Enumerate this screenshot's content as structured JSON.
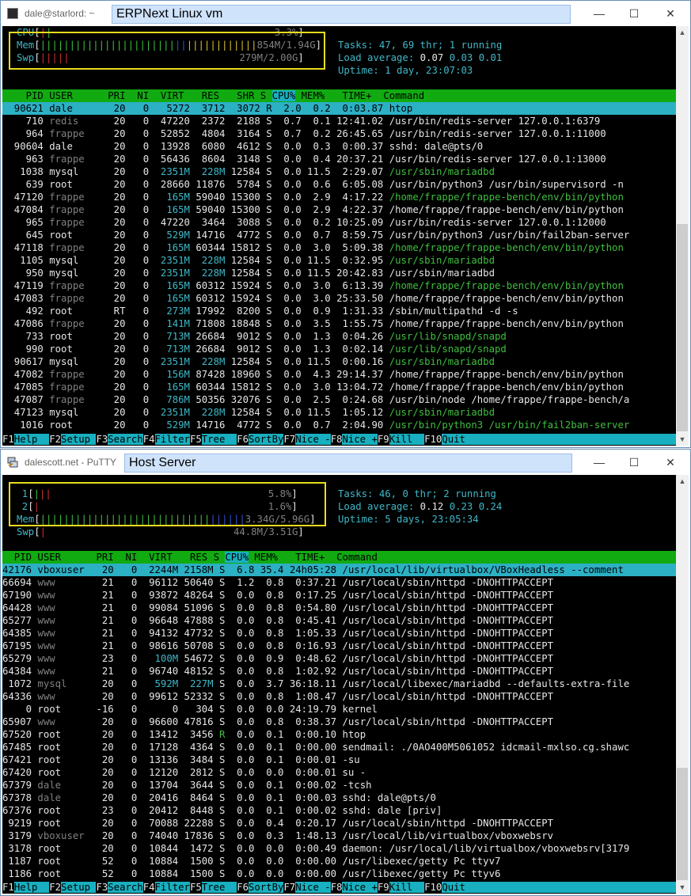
{
  "win1": {
    "app_title": "dale@starlord: ~",
    "label": "ERPNext Linux vm",
    "meters": {
      "cpu_label": "CPU",
      "cpu_value": "3.3%",
      "mem_label": "Mem",
      "mem_value": "854M/1.94G",
      "swp_label": "Swp",
      "swp_value": "279M/2.00G"
    },
    "summary": {
      "tasks_label": "Tasks:",
      "tasks_value": "47,",
      "thr_value": "69",
      "thr_label": "thr;",
      "running_value": "1",
      "running_label": "running",
      "load_label": "Load average:",
      "load1": "0.07",
      "load5": "0.03",
      "load15": "0.01",
      "uptime_label": "Uptime:",
      "uptime_value": "1 day, 23:07:03"
    },
    "header": "    PID USER      PRI  NI  VIRT   RES   SHR S CPU% MEM%   TIME+  Command",
    "rows": [
      {
        "pid": "90621",
        "user": "dale",
        "pri": "20",
        "ni": "0",
        "virt": "5272",
        "res": "3712",
        "shr": "3072",
        "s": "R",
        "cpu": "2.0",
        "mem": "0.2",
        "time": "0:03.87",
        "cmd": "htop",
        "sel": true
      },
      {
        "pid": "710",
        "user": "redis",
        "pri": "20",
        "ni": "0",
        "virt": "47220",
        "res": "2372",
        "shr": "2188",
        "s": "S",
        "cpu": "0.7",
        "mem": "0.1",
        "time": "12:41.02",
        "cmd": "/usr/bin/redis-server 127.0.0.1:6379"
      },
      {
        "pid": "964",
        "user": "frappe",
        "pri": "20",
        "ni": "0",
        "virt": "52852",
        "res": "4804",
        "shr": "3164",
        "s": "S",
        "cpu": "0.7",
        "mem": "0.2",
        "time": "26:45.65",
        "cmd": "/usr/bin/redis-server 127.0.0.1:11000"
      },
      {
        "pid": "90604",
        "user": "dale",
        "pri": "20",
        "ni": "0",
        "virt": "13928",
        "res": "6080",
        "shr": "4612",
        "s": "S",
        "cpu": "0.0",
        "mem": "0.3",
        "time": "0:00.37",
        "cmd": "sshd: dale@pts/0"
      },
      {
        "pid": "963",
        "user": "frappe",
        "pri": "20",
        "ni": "0",
        "virt": "56436",
        "res": "8604",
        "shr": "3148",
        "s": "S",
        "cpu": "0.0",
        "mem": "0.4",
        "time": "20:37.21",
        "cmd": "/usr/bin/redis-server 127.0.0.1:13000"
      },
      {
        "pid": "1038",
        "user": "mysql",
        "pri": "20",
        "ni": "0",
        "virt": "2351M",
        "res": "228M",
        "shr": "12584",
        "s": "S",
        "cpu": "0.0",
        "mem": "11.5",
        "time": "2:29.07",
        "cmd": "/usr/sbin/mariadbd",
        "green": true
      },
      {
        "pid": "639",
        "user": "root",
        "pri": "20",
        "ni": "0",
        "virt": "28660",
        "res": "11876",
        "shr": "5784",
        "s": "S",
        "cpu": "0.0",
        "mem": "0.6",
        "time": "6:05.08",
        "cmd": "/usr/bin/python3 /usr/bin/supervisord -n"
      },
      {
        "pid": "47120",
        "user": "frappe",
        "pri": "20",
        "ni": "0",
        "virt": "165M",
        "res": "59040",
        "shr": "15300",
        "s": "S",
        "cpu": "0.0",
        "mem": "2.9",
        "time": "4:17.22",
        "cmd": "/home/frappe/frappe-bench/env/bin/python",
        "green": true
      },
      {
        "pid": "47084",
        "user": "frappe",
        "pri": "20",
        "ni": "0",
        "virt": "165M",
        "res": "59040",
        "shr": "15300",
        "s": "S",
        "cpu": "0.0",
        "mem": "2.9",
        "time": "4:22.37",
        "cmd": "/home/frappe/frappe-bench/env/bin/python"
      },
      {
        "pid": "965",
        "user": "frappe",
        "pri": "20",
        "ni": "0",
        "virt": "47220",
        "res": "3464",
        "shr": "3088",
        "s": "S",
        "cpu": "0.0",
        "mem": "0.2",
        "time": "10:25.09",
        "cmd": "/usr/bin/redis-server 127.0.0.1:12000"
      },
      {
        "pid": "645",
        "user": "root",
        "pri": "20",
        "ni": "0",
        "virt": "529M",
        "res": "14716",
        "shr": "4772",
        "s": "S",
        "cpu": "0.0",
        "mem": "0.7",
        "time": "8:59.75",
        "cmd": "/usr/bin/python3 /usr/bin/fail2ban-server"
      },
      {
        "pid": "47118",
        "user": "frappe",
        "pri": "20",
        "ni": "0",
        "virt": "165M",
        "res": "60344",
        "shr": "15812",
        "s": "S",
        "cpu": "0.0",
        "mem": "3.0",
        "time": "5:09.38",
        "cmd": "/home/frappe/frappe-bench/env/bin/python",
        "green": true
      },
      {
        "pid": "1105",
        "user": "mysql",
        "pri": "20",
        "ni": "0",
        "virt": "2351M",
        "res": "228M",
        "shr": "12584",
        "s": "S",
        "cpu": "0.0",
        "mem": "11.5",
        "time": "0:32.95",
        "cmd": "/usr/sbin/mariadbd",
        "green": true
      },
      {
        "pid": "950",
        "user": "mysql",
        "pri": "20",
        "ni": "0",
        "virt": "2351M",
        "res": "228M",
        "shr": "12584",
        "s": "S",
        "cpu": "0.0",
        "mem": "11.5",
        "time": "20:42.83",
        "cmd": "/usr/sbin/mariadbd"
      },
      {
        "pid": "47119",
        "user": "frappe",
        "pri": "20",
        "ni": "0",
        "virt": "165M",
        "res": "60312",
        "shr": "15924",
        "s": "S",
        "cpu": "0.0",
        "mem": "3.0",
        "time": "6:13.39",
        "cmd": "/home/frappe/frappe-bench/env/bin/python",
        "green": true
      },
      {
        "pid": "47083",
        "user": "frappe",
        "pri": "20",
        "ni": "0",
        "virt": "165M",
        "res": "60312",
        "shr": "15924",
        "s": "S",
        "cpu": "0.0",
        "mem": "3.0",
        "time": "25:33.50",
        "cmd": "/home/frappe/frappe-bench/env/bin/python"
      },
      {
        "pid": "492",
        "user": "root",
        "pri": "RT",
        "ni": "0",
        "virt": "273M",
        "res": "17992",
        "shr": "8200",
        "s": "S",
        "cpu": "0.0",
        "mem": "0.9",
        "time": "1:31.33",
        "cmd": "/sbin/multipathd -d -s"
      },
      {
        "pid": "47086",
        "user": "frappe",
        "pri": "20",
        "ni": "0",
        "virt": "141M",
        "res": "71808",
        "shr": "18848",
        "s": "S",
        "cpu": "0.0",
        "mem": "3.5",
        "time": "1:55.75",
        "cmd": "/home/frappe/frappe-bench/env/bin/python"
      },
      {
        "pid": "733",
        "user": "root",
        "pri": "20",
        "ni": "0",
        "virt": "713M",
        "res": "26684",
        "shr": "9012",
        "s": "S",
        "cpu": "0.0",
        "mem": "1.3",
        "time": "0:04.26",
        "cmd": "/usr/lib/snapd/snapd",
        "green": true
      },
      {
        "pid": "990",
        "user": "root",
        "pri": "20",
        "ni": "0",
        "virt": "713M",
        "res": "26684",
        "shr": "9012",
        "s": "S",
        "cpu": "0.0",
        "mem": "1.3",
        "time": "0:02.14",
        "cmd": "/usr/lib/snapd/snapd",
        "green": true
      },
      {
        "pid": "90617",
        "user": "mysql",
        "pri": "20",
        "ni": "0",
        "virt": "2351M",
        "res": "228M",
        "shr": "12584",
        "s": "S",
        "cpu": "0.0",
        "mem": "11.5",
        "time": "0:00.16",
        "cmd": "/usr/sbin/mariadbd",
        "green": true
      },
      {
        "pid": "47082",
        "user": "frappe",
        "pri": "20",
        "ni": "0",
        "virt": "156M",
        "res": "87428",
        "shr": "18960",
        "s": "S",
        "cpu": "0.0",
        "mem": "4.3",
        "time": "29:14.37",
        "cmd": "/home/frappe/frappe-bench/env/bin/python"
      },
      {
        "pid": "47085",
        "user": "frappe",
        "pri": "20",
        "ni": "0",
        "virt": "165M",
        "res": "60344",
        "shr": "15812",
        "s": "S",
        "cpu": "0.0",
        "mem": "3.0",
        "time": "13:04.72",
        "cmd": "/home/frappe/frappe-bench/env/bin/python"
      },
      {
        "pid": "47087",
        "user": "frappe",
        "pri": "20",
        "ni": "0",
        "virt": "786M",
        "res": "50356",
        "shr": "32076",
        "s": "S",
        "cpu": "0.0",
        "mem": "2.5",
        "time": "0:24.68",
        "cmd": "/usr/bin/node /home/frappe/frappe-bench/a"
      },
      {
        "pid": "47123",
        "user": "mysql",
        "pri": "20",
        "ni": "0",
        "virt": "2351M",
        "res": "228M",
        "shr": "12584",
        "s": "S",
        "cpu": "0.0",
        "mem": "11.5",
        "time": "1:05.12",
        "cmd": "/usr/sbin/mariadbd",
        "green": true
      },
      {
        "pid": "1016",
        "user": "root",
        "pri": "20",
        "ni": "0",
        "virt": "529M",
        "res": "14716",
        "shr": "4772",
        "s": "S",
        "cpu": "0.0",
        "mem": "0.7",
        "time": "2:04.90",
        "cmd": "/usr/bin/python3 /usr/bin/fail2ban-server",
        "green": true
      }
    ]
  },
  "win2": {
    "app_title": "dalescott.net - PuTTY",
    "label": "Host Server",
    "meters": {
      "cpu1_label": "1",
      "cpu1_value": "5.8%",
      "cpu2_label": "2",
      "cpu2_value": "1.6%",
      "mem_label": "Mem",
      "mem_value": "3.34G/5.96G",
      "swp_label": "Swp",
      "swp_value": "44.8M/3.51G"
    },
    "summary": {
      "tasks_label": "Tasks:",
      "tasks_value": "46,",
      "thr_value": "0",
      "thr_label": "thr;",
      "running_value": "2",
      "running_label": "running",
      "load_label": "Load average:",
      "load1": "0.12",
      "load5": "0.23",
      "load15": "0.24",
      "uptime_label": "Uptime:",
      "uptime_value": "5 days, 23:05:34"
    },
    "header": "  PID USER      PRI  NI  VIRT   RES S CPU% MEM%   TIME+  Command",
    "rows": [
      {
        "pid": "42176",
        "user": "vboxuser",
        "pri": "20",
        "ni": "0",
        "virt": "2244M",
        "res": "2158M",
        "s": "S",
        "cpu": "6.8",
        "mem": "35.4",
        "time": "24h05:28",
        "cmd": "/usr/local/lib/virtualbox/VBoxHeadless --comment",
        "sel": true
      },
      {
        "pid": "66694",
        "user": "www",
        "pri": "21",
        "ni": "0",
        "virt": "96112",
        "res": "50640",
        "s": "S",
        "cpu": "1.2",
        "mem": "0.8",
        "time": "0:37.21",
        "cmd": "/usr/local/sbin/httpd -DNOHTTPACCEPT"
      },
      {
        "pid": "67190",
        "user": "www",
        "pri": "21",
        "ni": "0",
        "virt": "93872",
        "res": "48264",
        "s": "S",
        "cpu": "0.0",
        "mem": "0.8",
        "time": "0:17.25",
        "cmd": "/usr/local/sbin/httpd -DNOHTTPACCEPT"
      },
      {
        "pid": "64428",
        "user": "www",
        "pri": "21",
        "ni": "0",
        "virt": "99084",
        "res": "51096",
        "s": "S",
        "cpu": "0.0",
        "mem": "0.8",
        "time": "0:54.80",
        "cmd": "/usr/local/sbin/httpd -DNOHTTPACCEPT"
      },
      {
        "pid": "65277",
        "user": "www",
        "pri": "21",
        "ni": "0",
        "virt": "96648",
        "res": "47888",
        "s": "S",
        "cpu": "0.0",
        "mem": "0.8",
        "time": "0:45.41",
        "cmd": "/usr/local/sbin/httpd -DNOHTTPACCEPT"
      },
      {
        "pid": "64385",
        "user": "www",
        "pri": "21",
        "ni": "0",
        "virt": "94132",
        "res": "47732",
        "s": "S",
        "cpu": "0.0",
        "mem": "0.8",
        "time": "1:05.33",
        "cmd": "/usr/local/sbin/httpd -DNOHTTPACCEPT"
      },
      {
        "pid": "67195",
        "user": "www",
        "pri": "21",
        "ni": "0",
        "virt": "98616",
        "res": "50708",
        "s": "S",
        "cpu": "0.0",
        "mem": "0.8",
        "time": "0:16.93",
        "cmd": "/usr/local/sbin/httpd -DNOHTTPACCEPT"
      },
      {
        "pid": "65279",
        "user": "www",
        "pri": "23",
        "ni": "0",
        "virt": "100M",
        "res": "54672",
        "s": "S",
        "cpu": "0.0",
        "mem": "0.9",
        "time": "0:48.62",
        "cmd": "/usr/local/sbin/httpd -DNOHTTPACCEPT"
      },
      {
        "pid": "64384",
        "user": "www",
        "pri": "21",
        "ni": "0",
        "virt": "96740",
        "res": "48152",
        "s": "S",
        "cpu": "0.0",
        "mem": "0.8",
        "time": "1:02.92",
        "cmd": "/usr/local/sbin/httpd -DNOHTTPACCEPT"
      },
      {
        "pid": "1072",
        "user": "mysql",
        "pri": "20",
        "ni": "0",
        "virt": "592M",
        "res": "227M",
        "s": "S",
        "cpu": "0.0",
        "mem": "3.7",
        "time": "36:18.11",
        "cmd": "/usr/local/libexec/mariadbd --defaults-extra-file"
      },
      {
        "pid": "64336",
        "user": "www",
        "pri": "20",
        "ni": "0",
        "virt": "99612",
        "res": "52332",
        "s": "S",
        "cpu": "0.0",
        "mem": "0.8",
        "time": "1:08.47",
        "cmd": "/usr/local/sbin/httpd -DNOHTTPACCEPT"
      },
      {
        "pid": "0",
        "user": "root",
        "pri": "-16",
        "ni": "0",
        "virt": "0",
        "res": "304",
        "s": "S",
        "cpu": "0.0",
        "mem": "0.0",
        "time": "24:19.79",
        "cmd": "kernel"
      },
      {
        "pid": "65907",
        "user": "www",
        "pri": "20",
        "ni": "0",
        "virt": "96600",
        "res": "47816",
        "s": "S",
        "cpu": "0.0",
        "mem": "0.8",
        "time": "0:38.37",
        "cmd": "/usr/local/sbin/httpd -DNOHTTPACCEPT"
      },
      {
        "pid": "67520",
        "user": "root",
        "pri": "20",
        "ni": "0",
        "virt": "13412",
        "res": "3456",
        "s": "R",
        "cpu": "0.0",
        "mem": "0.1",
        "time": "0:00.10",
        "cmd": "htop"
      },
      {
        "pid": "67485",
        "user": "root",
        "pri": "20",
        "ni": "0",
        "virt": "17128",
        "res": "4364",
        "s": "S",
        "cpu": "0.0",
        "mem": "0.1",
        "time": "0:00.00",
        "cmd": "sendmail: ./0AO400M5061052 idcmail-mxlso.cg.shawc"
      },
      {
        "pid": "67421",
        "user": "root",
        "pri": "20",
        "ni": "0",
        "virt": "13136",
        "res": "3484",
        "s": "S",
        "cpu": "0.0",
        "mem": "0.1",
        "time": "0:00.01",
        "cmd": "-su"
      },
      {
        "pid": "67420",
        "user": "root",
        "pri": "20",
        "ni": "0",
        "virt": "12120",
        "res": "2812",
        "s": "S",
        "cpu": "0.0",
        "mem": "0.0",
        "time": "0:00.01",
        "cmd": "su -"
      },
      {
        "pid": "67379",
        "user": "dale",
        "pri": "20",
        "ni": "0",
        "virt": "13704",
        "res": "3644",
        "s": "S",
        "cpu": "0.0",
        "mem": "0.1",
        "time": "0:00.02",
        "cmd": "-tcsh"
      },
      {
        "pid": "67378",
        "user": "dale",
        "pri": "20",
        "ni": "0",
        "virt": "20416",
        "res": "8464",
        "s": "S",
        "cpu": "0.0",
        "mem": "0.1",
        "time": "0:00.03",
        "cmd": "sshd: dale@pts/0"
      },
      {
        "pid": "67376",
        "user": "root",
        "pri": "23",
        "ni": "0",
        "virt": "20412",
        "res": "8448",
        "s": "S",
        "cpu": "0.0",
        "mem": "0.1",
        "time": "0:00.02",
        "cmd": "sshd: dale [priv]"
      },
      {
        "pid": "9219",
        "user": "root",
        "pri": "20",
        "ni": "0",
        "virt": "70088",
        "res": "22288",
        "s": "S",
        "cpu": "0.0",
        "mem": "0.4",
        "time": "0:20.17",
        "cmd": "/usr/local/sbin/httpd -DNOHTTPACCEPT"
      },
      {
        "pid": "3179",
        "user": "vboxuser",
        "pri": "20",
        "ni": "0",
        "virt": "74040",
        "res": "17836",
        "s": "S",
        "cpu": "0.0",
        "mem": "0.3",
        "time": "1:48.13",
        "cmd": "/usr/local/lib/virtualbox/vboxwebsrv"
      },
      {
        "pid": "3178",
        "user": "root",
        "pri": "20",
        "ni": "0",
        "virt": "10844",
        "res": "1472",
        "s": "S",
        "cpu": "0.0",
        "mem": "0.0",
        "time": "0:00.49",
        "cmd": "daemon: /usr/local/lib/virtualbox/vboxwebsrv[3179"
      },
      {
        "pid": "1187",
        "user": "root",
        "pri": "52",
        "ni": "0",
        "virt": "10884",
        "res": "1500",
        "s": "S",
        "cpu": "0.0",
        "mem": "0.0",
        "time": "0:00.00",
        "cmd": "/usr/libexec/getty Pc ttyv7"
      },
      {
        "pid": "1186",
        "user": "root",
        "pri": "52",
        "ni": "0",
        "virt": "10884",
        "res": "1500",
        "s": "S",
        "cpu": "0.0",
        "mem": "0.0",
        "time": "0:00.00",
        "cmd": "/usr/libexec/getty Pc ttyv6"
      }
    ]
  },
  "fkeys": [
    {
      "key": "F1",
      "label": "Help"
    },
    {
      "key": "F2",
      "label": "Setup"
    },
    {
      "key": "F3",
      "label": "Search"
    },
    {
      "key": "F4",
      "label": "Filter"
    },
    {
      "key": "F5",
      "label": "Tree"
    },
    {
      "key": "F6",
      "label": "SortBy"
    },
    {
      "key": "F7",
      "label": "Nice -"
    },
    {
      "key": "F8",
      "label": "Nice +"
    },
    {
      "key": "F9",
      "label": "Kill"
    },
    {
      "key": "F10",
      "label": "Quit"
    }
  ],
  "window_buttons": {
    "minimize": "—",
    "maximize": "☐",
    "close": "✕"
  },
  "colors": {
    "terminal_bg": "#000000",
    "header_green": "#11aa11",
    "selected_cyan": "#2cb0c4",
    "annotation_yellow": "#e8dc20"
  }
}
